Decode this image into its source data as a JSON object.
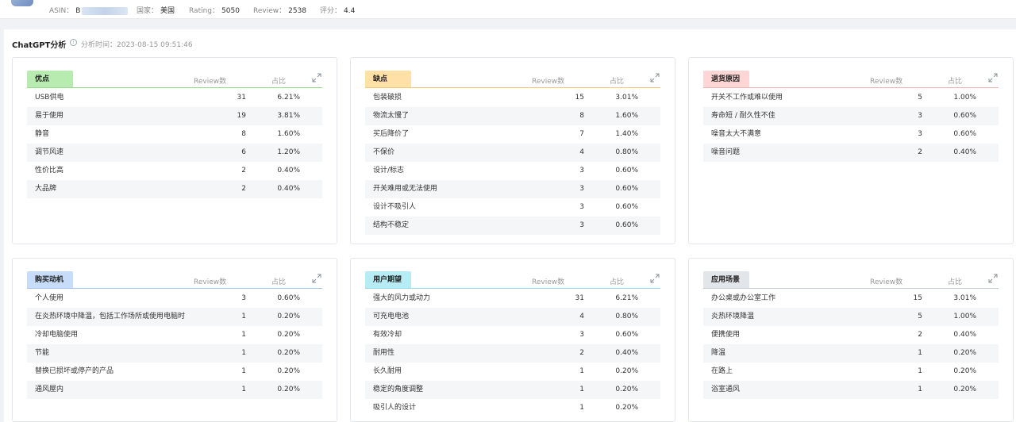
{
  "header": {
    "asin_label": "ASIN：",
    "asin_value": "B",
    "country_label": "国家：",
    "country_value": "美国",
    "rating_label": "Rating：",
    "rating_value": "5050",
    "review_label": "Review：",
    "review_value": "2538",
    "score_label": "评分：",
    "score_value": "4.4"
  },
  "section": {
    "title": "ChatGPT分析",
    "time_label": "分析时间：2023-08-15 09:51:46"
  },
  "columns": {
    "review": "Review数",
    "ratio": "占比"
  },
  "cards": [
    {
      "tag": "优点",
      "color": "#b7ebb0",
      "line": "#95de8a",
      "rows": [
        {
          "label": "USB供电",
          "count": "31",
          "pct": "6.21%"
        },
        {
          "label": "易于使用",
          "count": "19",
          "pct": "3.81%"
        },
        {
          "label": "静音",
          "count": "8",
          "pct": "1.60%"
        },
        {
          "label": "调节风速",
          "count": "6",
          "pct": "1.20%"
        },
        {
          "label": "性价比高",
          "count": "2",
          "pct": "0.40%"
        },
        {
          "label": "大品牌",
          "count": "2",
          "pct": "0.40%"
        }
      ]
    },
    {
      "tag": "缺点",
      "color": "#ffe0a6",
      "line": "#f7c77c",
      "rows": [
        {
          "label": "包装破损",
          "count": "15",
          "pct": "3.01%"
        },
        {
          "label": "物流太慢了",
          "count": "8",
          "pct": "1.60%"
        },
        {
          "label": "买后降价了",
          "count": "7",
          "pct": "1.40%"
        },
        {
          "label": "不保价",
          "count": "4",
          "pct": "0.80%"
        },
        {
          "label": "设计/标志",
          "count": "3",
          "pct": "0.60%"
        },
        {
          "label": "开关难用或无法使用",
          "count": "3",
          "pct": "0.60%"
        },
        {
          "label": "设计不吸引人",
          "count": "3",
          "pct": "0.60%"
        },
        {
          "label": "结构不稳定",
          "count": "3",
          "pct": "0.60%"
        }
      ]
    },
    {
      "tag": "退货原因",
      "color": "#ffd6d6",
      "line": "#f5b3b3",
      "rows": [
        {
          "label": "开关不工作或难以使用",
          "count": "5",
          "pct": "1.00%"
        },
        {
          "label": "寿命短 / 耐久性不佳",
          "count": "3",
          "pct": "0.60%"
        },
        {
          "label": "噪音太大不满意",
          "count": "3",
          "pct": "0.60%"
        },
        {
          "label": "噪音问题",
          "count": "2",
          "pct": "0.40%"
        }
      ]
    },
    {
      "tag": "购买动机",
      "color": "#c7dcf8",
      "line": "#a6c4ee",
      "rows": [
        {
          "label": "个人使用",
          "count": "3",
          "pct": "0.60%"
        },
        {
          "label": "在炎热环境中降温，包括工作场所或使用电脑时",
          "count": "1",
          "pct": "0.20%"
        },
        {
          "label": "冷却电脑使用",
          "count": "1",
          "pct": "0.20%"
        },
        {
          "label": "节能",
          "count": "1",
          "pct": "0.20%"
        },
        {
          "label": "替换已损坏或停产的产品",
          "count": "1",
          "pct": "0.20%"
        },
        {
          "label": "通风屋内",
          "count": "1",
          "pct": "0.20%"
        }
      ]
    },
    {
      "tag": "用户期望",
      "color": "#b8ecf4",
      "line": "#8fd9e8",
      "rows": [
        {
          "label": "强大的风力或动力",
          "count": "31",
          "pct": "6.21%"
        },
        {
          "label": "可充电电池",
          "count": "4",
          "pct": "0.80%"
        },
        {
          "label": "有效冷却",
          "count": "3",
          "pct": "0.60%"
        },
        {
          "label": "耐用性",
          "count": "2",
          "pct": "0.40%"
        },
        {
          "label": "长久耐用",
          "count": "1",
          "pct": "0.20%"
        },
        {
          "label": "稳定的角度调整",
          "count": "1",
          "pct": "0.20%"
        },
        {
          "label": "吸引人的设计",
          "count": "1",
          "pct": "0.20%"
        }
      ]
    },
    {
      "tag": "应用场景",
      "color": "#e2e5ea",
      "line": "#c8ccd3",
      "rows": [
        {
          "label": "办公桌或办公室工作",
          "count": "15",
          "pct": "3.01%"
        },
        {
          "label": "炎热环境降温",
          "count": "5",
          "pct": "1.00%"
        },
        {
          "label": "便携使用",
          "count": "2",
          "pct": "0.40%"
        },
        {
          "label": "降温",
          "count": "1",
          "pct": "0.20%"
        },
        {
          "label": "在路上",
          "count": "1",
          "pct": "0.20%"
        },
        {
          "label": "浴室通风",
          "count": "1",
          "pct": "0.20%"
        }
      ]
    }
  ]
}
